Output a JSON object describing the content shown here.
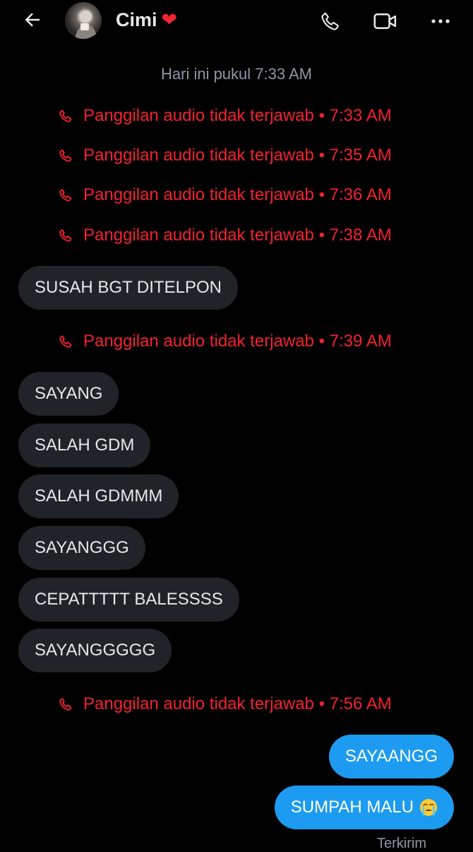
{
  "header": {
    "contact_name": "Cimi",
    "name_emoji": "❤",
    "icons": {
      "back": "back-arrow-icon",
      "avatar": "contact-avatar",
      "phone": "phone-icon",
      "video": "video-camera-icon",
      "more": "more-dots-icon"
    }
  },
  "date_separator": "Hari ini pukul 7:33 AM",
  "missed_calls": [
    {
      "text": "Panggilan audio tidak terjawab • 7:33 AM"
    },
    {
      "text": "Panggilan audio tidak terjawab • 7:35 AM"
    },
    {
      "text": "Panggilan audio tidak terjawab • 7:36 AM"
    },
    {
      "text": "Panggilan audio tidak terjawab • 7:38 AM"
    },
    {
      "text": "Panggilan audio tidak terjawab • 7:39 AM"
    },
    {
      "text": "Panggilan audio tidak terjawab • 7:56 AM"
    }
  ],
  "incoming_messages": [
    {
      "text": "SUSAH BGT DITELPON"
    },
    {
      "text": "SAYANG"
    },
    {
      "text": "SALAH GDM"
    },
    {
      "text": "SALAH GDMMM"
    },
    {
      "text": "SAYANGGG"
    },
    {
      "text": "CEPATTTTT BALESSSS"
    },
    {
      "text": "SAYANGGGGG"
    }
  ],
  "outgoing_messages": [
    {
      "text": "SAYAANGG"
    },
    {
      "text": "SUMPAH MALU",
      "emoji": "crying-face-emoji"
    }
  ],
  "delivery_status": "Terkirim",
  "colors": {
    "background": "#000000",
    "missed_call": "#f4212e",
    "incoming_bubble": "#202327",
    "outgoing_bubble": "#1d9bf0",
    "muted_text": "#8b98a5"
  }
}
